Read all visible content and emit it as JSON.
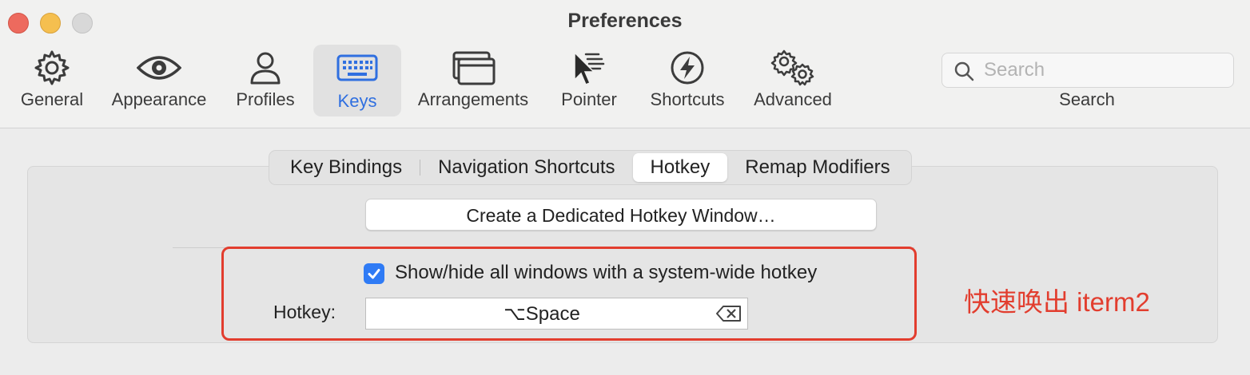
{
  "window": {
    "title": "Preferences",
    "controls": [
      "close",
      "minimize",
      "zoom"
    ]
  },
  "toolbar": {
    "items": [
      {
        "label": "General",
        "icon": "gear-icon"
      },
      {
        "label": "Appearance",
        "icon": "eye-icon"
      },
      {
        "label": "Profiles",
        "icon": "person-icon"
      },
      {
        "label": "Keys",
        "icon": "keyboard-icon",
        "selected": true
      },
      {
        "label": "Arrangements",
        "icon": "windows-icon"
      },
      {
        "label": "Pointer",
        "icon": "pointer-icon"
      },
      {
        "label": "Shortcuts",
        "icon": "bolt-icon"
      },
      {
        "label": "Advanced",
        "icon": "gears-icon"
      }
    ],
    "search": {
      "placeholder": "Search",
      "caption": "Search"
    }
  },
  "tabs": {
    "items": [
      "Key Bindings",
      "Navigation Shortcuts",
      "Hotkey",
      "Remap Modifiers"
    ],
    "selected": "Hotkey"
  },
  "hotkey_pane": {
    "create_button": "Create a Dedicated Hotkey Window…",
    "checkbox_label": "Show/hide all windows with a system-wide hotkey",
    "checkbox_checked": true,
    "hotkey_label": "Hotkey:",
    "hotkey_value": "⌥Space"
  },
  "annotation": {
    "text": "快速唤出 iterm2",
    "color": "#e23d2e"
  },
  "colors": {
    "accent": "#2f7bf5",
    "selected_label": "#2f6fe0",
    "annotation": "#e23d2e"
  }
}
